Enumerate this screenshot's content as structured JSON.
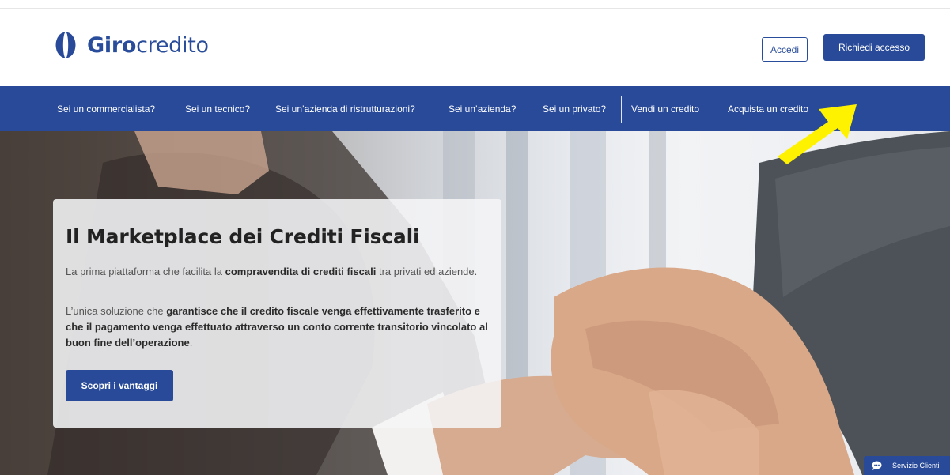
{
  "header": {
    "logo_bold": "Giro",
    "logo_light": "credito",
    "login_label": "Accedi",
    "request_access_label": "Richiedi accesso"
  },
  "nav": {
    "items": [
      {
        "label": "Sei un commercialista?"
      },
      {
        "label": "Sei un tecnico?"
      },
      {
        "label": "Sei un’azienda di ristrutturazioni?"
      },
      {
        "label": "Sei un’azienda?"
      },
      {
        "label": "Sei un privato?"
      },
      {
        "label": "Vendi un credito"
      },
      {
        "label": "Acquista un credito"
      }
    ]
  },
  "hero": {
    "title": "Il Marketplace dei Crediti Fiscali",
    "p1_a": "La prima piattaforma che facilita la ",
    "p1_b": "compravendita di crediti fiscali",
    "p1_c": " tra privati ed aziende.",
    "p2_a": "L’unica soluzione che ",
    "p2_b": "garantisce che il credito fiscale venga effettivamente trasferito e che il pagamento venga effettuato attraverso un conto corrente transitorio vincolato al buon fine dell’operazione",
    "p2_c": ".",
    "cta_label": "Scopri i vantaggi"
  },
  "support": {
    "label": "Servizio Clienti"
  },
  "colors": {
    "brand_blue": "#284a98",
    "arrow_yellow": "#fff200"
  }
}
